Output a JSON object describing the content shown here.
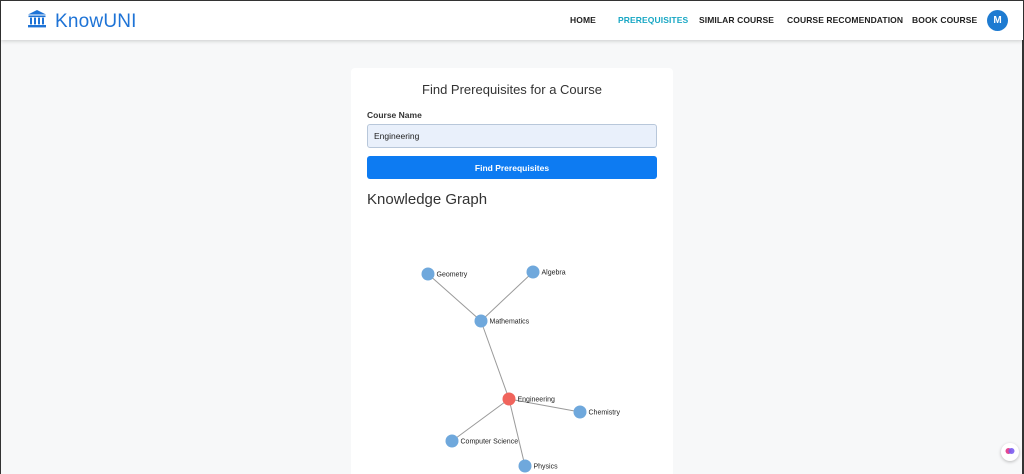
{
  "brand": {
    "name": "KnowUNI",
    "icon": "university-icon",
    "color": "#1e73d6"
  },
  "nav": {
    "items": [
      {
        "label": "HOME",
        "active": false
      },
      {
        "label": "PREREQUISITES",
        "active": true
      },
      {
        "label": "SIMILAR COURSE",
        "active": false
      },
      {
        "label": "COURSE RECOMENDATION",
        "active": false
      },
      {
        "label": "BOOK COURSE",
        "active": false
      }
    ],
    "active_color": "#18a7c4",
    "avatar_initial": "M",
    "avatar_color": "#1e7bd1"
  },
  "form": {
    "title": "Find Prerequisites for a Course",
    "field_label": "Course Name",
    "course_value": "Engineering",
    "button_label": "Find Prerequisites",
    "button_color": "#0d7bf2"
  },
  "graph": {
    "title": "Knowledge Graph",
    "node_color": "#6fa8dc",
    "selected_color": "#f0645c",
    "nodes": [
      {
        "id": "geometry",
        "label": "Geometry"
      },
      {
        "id": "algebra",
        "label": "Algebra"
      },
      {
        "id": "mathematics",
        "label": "Mathematics"
      },
      {
        "id": "engineering",
        "label": "Engineering",
        "selected": true
      },
      {
        "id": "chemistry",
        "label": "Chemistry"
      },
      {
        "id": "computer_science",
        "label": "Computer Science"
      },
      {
        "id": "physics",
        "label": "Physics"
      }
    ],
    "edges": [
      [
        "geometry",
        "mathematics"
      ],
      [
        "algebra",
        "mathematics"
      ],
      [
        "mathematics",
        "engineering"
      ],
      [
        "engineering",
        "chemistry"
      ],
      [
        "engineering",
        "computer_science"
      ],
      [
        "engineering",
        "physics"
      ]
    ]
  },
  "floating_button": {
    "icon": "assistant-icon"
  }
}
